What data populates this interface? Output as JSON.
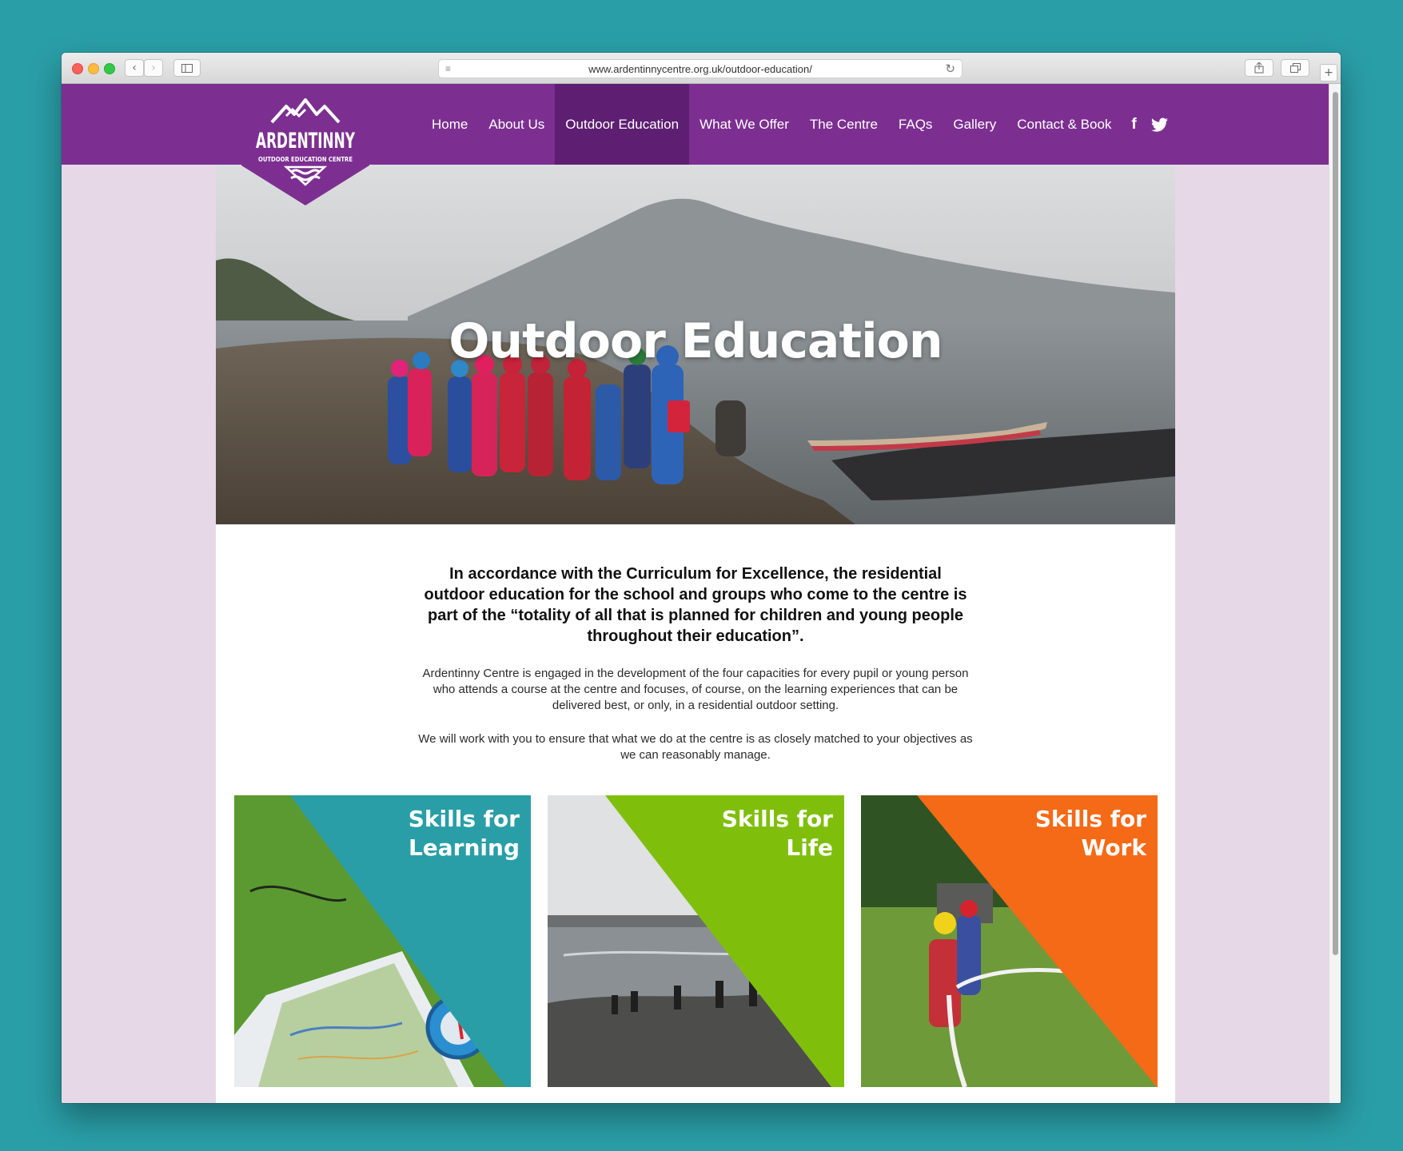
{
  "browser": {
    "url": "www.ardentinnycentre.org.uk/outdoor-education/"
  },
  "site": {
    "logo_text": "ARDENTINNY",
    "logo_subtext": "OUTDOOR EDUCATION CENTRE",
    "nav": [
      {
        "label": "Home",
        "active": false
      },
      {
        "label": "About Us",
        "active": false
      },
      {
        "label": "Outdoor Education",
        "active": true
      },
      {
        "label": "What We Offer",
        "active": false
      },
      {
        "label": "The Centre",
        "active": false
      },
      {
        "label": "FAQs",
        "active": false
      },
      {
        "label": "Gallery",
        "active": false
      },
      {
        "label": "Contact & Book",
        "active": false
      }
    ],
    "social": {
      "facebook": "f"
    },
    "colors": {
      "brand_purple": "#7c2f91",
      "active_purple": "#5e1f72",
      "page_bg": "#e7d8e8"
    }
  },
  "hero": {
    "title": "Outdoor Education"
  },
  "intro": {
    "lead": "In accordance with the Curriculum for Excellence, the residential outdoor education for the school and groups who come to the centre is part of the “totality of all that is planned for children and young people throughout their education”.",
    "paragraph_1": "Ardentinny Centre is engaged in the development of the four capacities for every pupil or young person who attends a course at the centre and focuses, of course, on the learning experiences that can be delivered best, or only, in a residential outdoor setting.",
    "paragraph_2": "We will work with you to ensure that what we do at the centre is as closely matched to your objectives as we can reasonably manage."
  },
  "tiles": [
    {
      "line1": "Skills for",
      "line2": "Learning",
      "color": "#2a9ea7"
    },
    {
      "line1": "Skills for",
      "line2": "Life",
      "color": "#7fbf0c"
    },
    {
      "line1": "Skills for",
      "line2": "Work",
      "color": "#f56a17"
    }
  ]
}
